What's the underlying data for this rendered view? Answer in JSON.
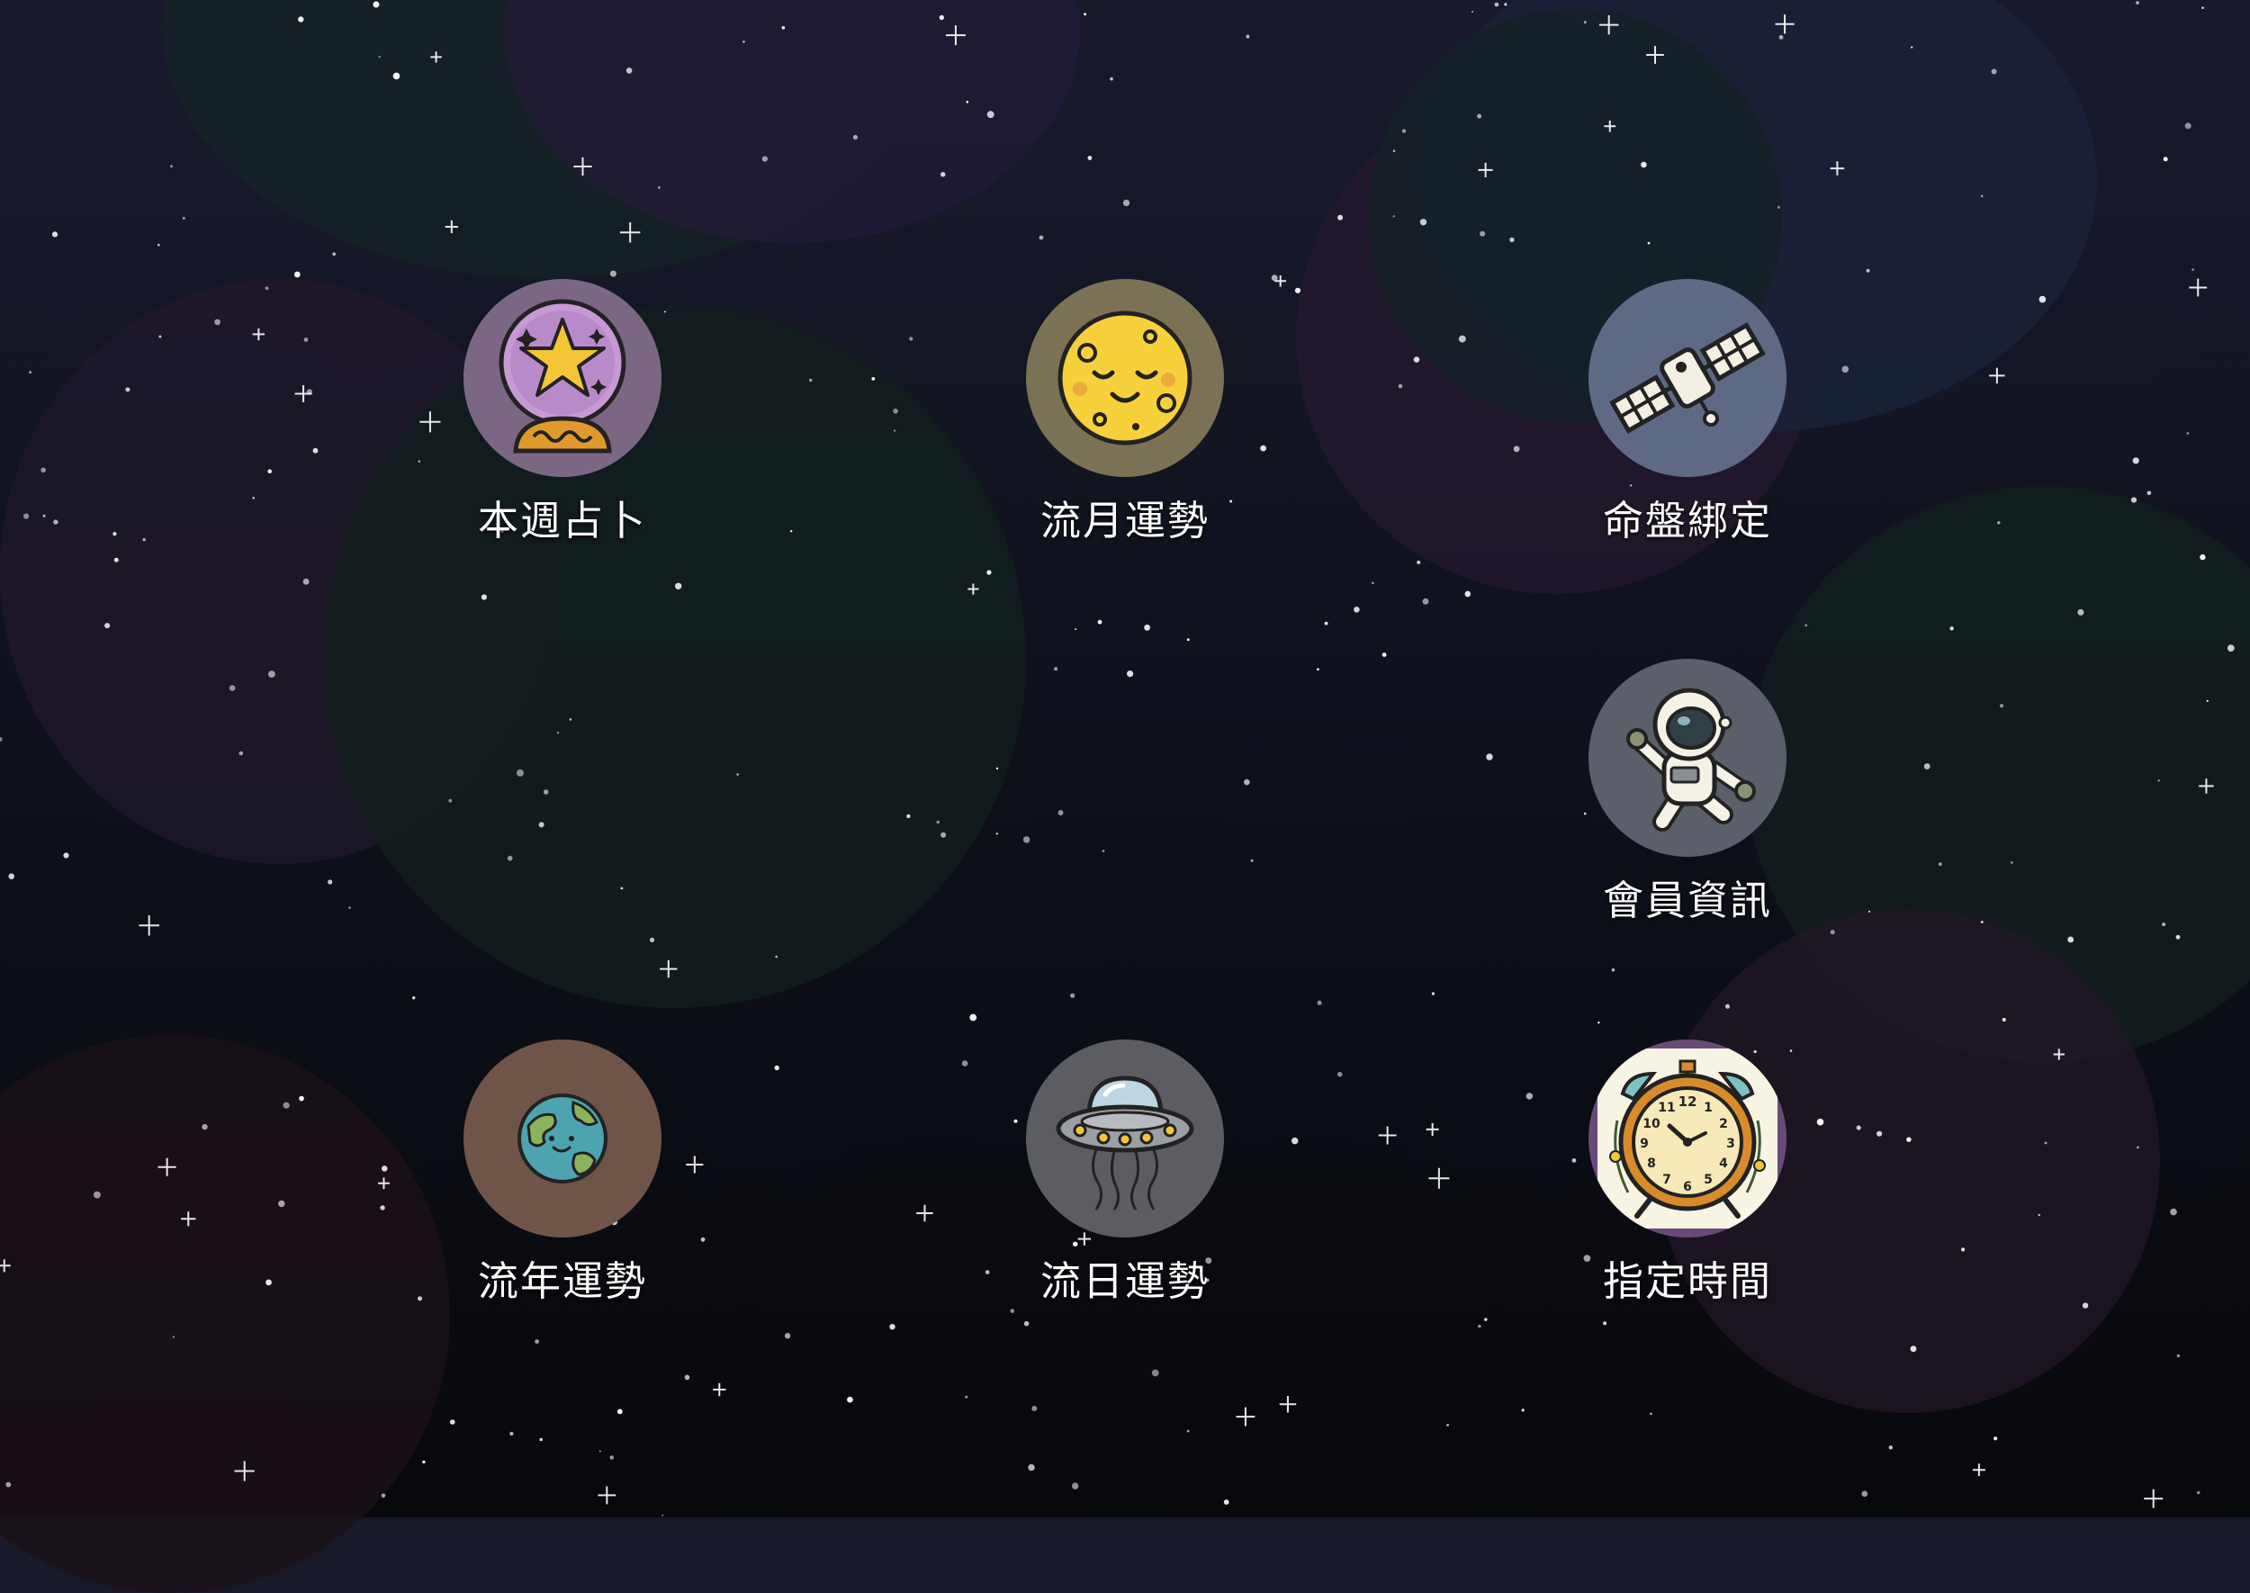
{
  "background": {
    "top_color": "#181a2c",
    "bottom_color": "#07080c"
  },
  "menu": {
    "items": [
      {
        "key": "weekly_divination",
        "label": "本週占卜",
        "icon": "crystal-ball-icon",
        "circle_color": "#7b6784"
      },
      {
        "key": "monthly_fortune",
        "label": "流月運勢",
        "icon": "moon-icon",
        "circle_color": "#7b7255"
      },
      {
        "key": "chart_binding",
        "label": "命盤綁定",
        "icon": "satellite-icon",
        "circle_color": "#5e6a84"
      },
      {
        "key": "member_info",
        "label": "會員資訊",
        "icon": "astronaut-icon",
        "circle_color": "#5a5f69"
      },
      {
        "key": "yearly_fortune",
        "label": "流年運勢",
        "icon": "earth-icon",
        "circle_color": "#6f5548"
      },
      {
        "key": "daily_fortune",
        "label": "流日運勢",
        "icon": "ufo-icon",
        "circle_color": "#5c5d63"
      },
      {
        "key": "specified_time",
        "label": "指定時間",
        "icon": "alarm-clock-icon",
        "circle_color": "#6a4a78"
      }
    ]
  }
}
